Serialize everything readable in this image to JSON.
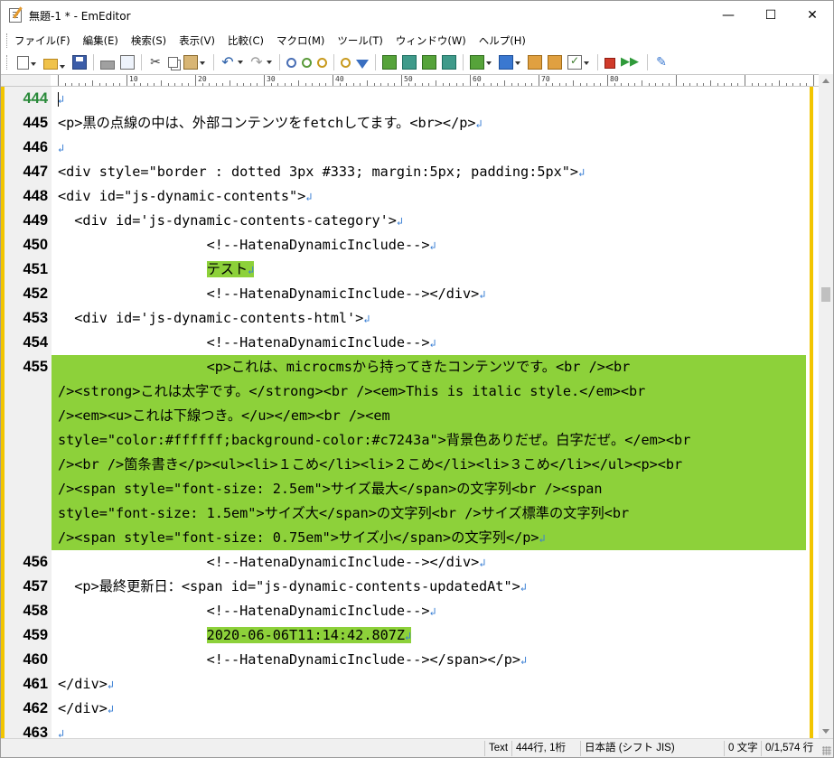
{
  "window": {
    "title": "無題-1 * - EmEditor",
    "minimize": "—",
    "maximize": "☐",
    "close": "✕"
  },
  "menu": [
    "ファイル(F)",
    "編集(E)",
    "検索(S)",
    "表示(V)",
    "比較(C)",
    "マクロ(M)",
    "ツール(T)",
    "ウィンドウ(W)",
    "ヘルプ(H)"
  ],
  "toolbar": [
    "new-document-icon",
    "open-folder-icon",
    "save-icon",
    "print-icon",
    "print-preview-icon",
    "cut-icon",
    "copy-icon",
    "paste-icon",
    "undo-icon",
    "redo-icon",
    "find-icon",
    "find-next-icon",
    "find-previous-icon",
    "highlight-icon",
    "filter-icon",
    "window-tile-icon",
    "window-cascade-icon",
    "sync-scroll-icon",
    "compare-icon",
    "output-bar-icon",
    "web-icon",
    "properties-icon",
    "settings-icon",
    "checklist-icon",
    "stop-macro-icon",
    "run-macro-icon",
    "tools-icon"
  ],
  "ruler": {
    "labels": [
      "10",
      "20",
      "30",
      "40",
      "50",
      "60",
      "70",
      "80"
    ]
  },
  "editor": {
    "eol_mark": "↲",
    "lines": [
      {
        "num": "444",
        "text": "",
        "current": true
      },
      {
        "num": "445",
        "text": "<p>黒の点線の中は、外部コンテンツをfetchしてます。<br></p>"
      },
      {
        "num": "446",
        "text": ""
      },
      {
        "num": "447",
        "text": "<div style=\"border : dotted 3px #333; margin:5px; padding:5px\">"
      },
      {
        "num": "448",
        "text": "<div id=\"js-dynamic-contents\">"
      },
      {
        "num": "449",
        "text": "  <div id='js-dynamic-contents-category'>"
      },
      {
        "num": "450",
        "text": "                  <!--HatenaDynamicInclude-->"
      },
      {
        "num": "451",
        "indent": "                  ",
        "highlight": "テスト"
      },
      {
        "num": "452",
        "text": "                  <!--HatenaDynamicInclude--></div>"
      },
      {
        "num": "453",
        "text": "  <div id='js-dynamic-contents-html'>"
      },
      {
        "num": "454",
        "text": "                  <!--HatenaDynamicInclude-->"
      }
    ],
    "wrapped_line": {
      "num": "455",
      "rows": [
        "                  <p>これは、microcmsから持ってきたコンテンツです。<br /><br",
        "/><strong>これは太字です。</strong><br /><em>This is italic style.</em><br",
        "/><em><u>これは下線つき。</u></em><br /><em",
        "style=\"color:#ffffff;background-color:#c7243a\">背景色ありだぜ。白字だぜ。</em><br",
        "/><br />箇条書き</p><ul><li>１こめ</li><li>２こめ</li><li>３こめ</li></ul><p><br",
        "/><span style=\"font-size: 2.5em\">サイズ最大</span>の文字列<br /><span",
        "style=\"font-size: 1.5em\">サイズ大</span>の文字列<br />サイズ標準の文字列<br",
        "/><span style=\"font-size: 0.75em\">サイズ小</span>の文字列</p>"
      ]
    },
    "lines_after": [
      {
        "num": "456",
        "text": "                  <!--HatenaDynamicInclude--></div>"
      },
      {
        "num": "457",
        "text": "  <p>最終更新日：<span id=\"js-dynamic-contents-updatedAt\">"
      },
      {
        "num": "458",
        "text": "                  <!--HatenaDynamicInclude-->"
      },
      {
        "num": "459",
        "indent": "                  ",
        "highlight": "2020-06-06T11:14:42.807Z"
      },
      {
        "num": "460",
        "text": "                  <!--HatenaDynamicInclude--></span></p>"
      },
      {
        "num": "461",
        "text": "</div>"
      },
      {
        "num": "462",
        "text": "</div>"
      },
      {
        "num": "463",
        "text": ""
      }
    ]
  },
  "status": {
    "mode": "Text",
    "position": "444行, 1桁",
    "encoding": "日本語 (シフト JIS)",
    "chars": "0 文字",
    "lines": "0/1,574 行"
  }
}
